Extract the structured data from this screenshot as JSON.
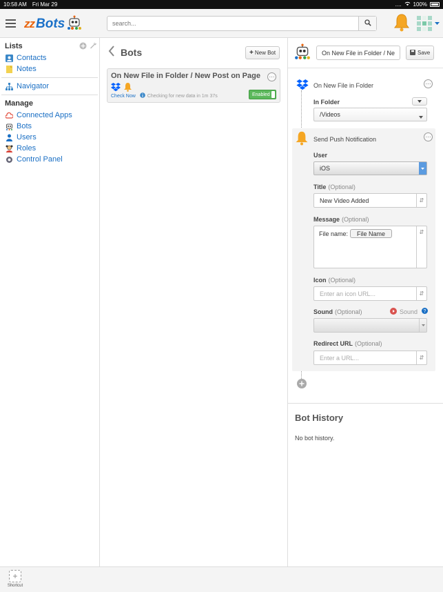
{
  "status_bar": {
    "time": "10:58 AM",
    "date": "Fri Mar 29",
    "signal": "....",
    "battery": "100%"
  },
  "header": {
    "logo_prefix": "zz",
    "logo_text": "Bots",
    "search_placeholder": "search...",
    "icons": [
      "menu-icon",
      "robot-icon",
      "search-icon",
      "bell-icon",
      "grid-app-icon",
      "chevron-down-icon"
    ]
  },
  "sidebar": {
    "lists_heading": "Lists",
    "lists": [
      {
        "label": "Contacts",
        "icon": "contacts-icon"
      },
      {
        "label": "Notes",
        "icon": "notes-icon"
      }
    ],
    "navigator": {
      "label": "Navigator",
      "icon": "sitemap-icon"
    },
    "manage_heading": "Manage",
    "manage": [
      {
        "label": "Connected Apps",
        "icon": "cloud-icon"
      },
      {
        "label": "Bots",
        "icon": "robot-icon"
      },
      {
        "label": "Users",
        "icon": "user-icon"
      },
      {
        "label": "Roles",
        "icon": "roles-icon"
      },
      {
        "label": "Control Panel",
        "icon": "gear-icon"
      }
    ]
  },
  "bots_panel": {
    "title": "Bots",
    "new_bot_label": "New Bot",
    "bot": {
      "name": "On New File in Folder / New Post on Page",
      "check_now": "Check Now",
      "status_text": "Checking for new data in 1m 37s",
      "toggle_label": "Enabled",
      "enabled": true
    }
  },
  "editor": {
    "bot_name_value": "On New File in Folder / New Post on Page",
    "save_label": "Save",
    "trigger": {
      "title": "On New File in Folder",
      "folder_label": "In Folder",
      "folder_value": "/Videos"
    },
    "action": {
      "title": "Send Push Notification",
      "user_label": "User",
      "user_value": "iOS",
      "title_label": "Title",
      "title_optional": "(Optional)",
      "title_value": "New Video Added",
      "message_label": "Message",
      "message_optional": "(Optional)",
      "message_prefix": "File name:",
      "message_token": "File Name",
      "icon_label": "Icon",
      "icon_optional": "(Optional)",
      "icon_placeholder": "Enter an icon URL...",
      "sound_label": "Sound",
      "sound_optional": "(Optional)",
      "sound_preview_label": "Sound",
      "redirect_label": "Redirect URL",
      "redirect_optional": "(Optional)",
      "redirect_placeholder": "Enter a URL..."
    },
    "history_title": "Bot History",
    "history_empty": "No bot history."
  },
  "footer": {
    "shortcut_label": "Shortcut"
  },
  "colors": {
    "link": "#1a6fc4",
    "enabled": "#5cb85c",
    "logo_orange": "#e9640d",
    "logo_blue": "#1a70c8",
    "bell": "#f5a623",
    "dropbox": "#0061fe"
  }
}
